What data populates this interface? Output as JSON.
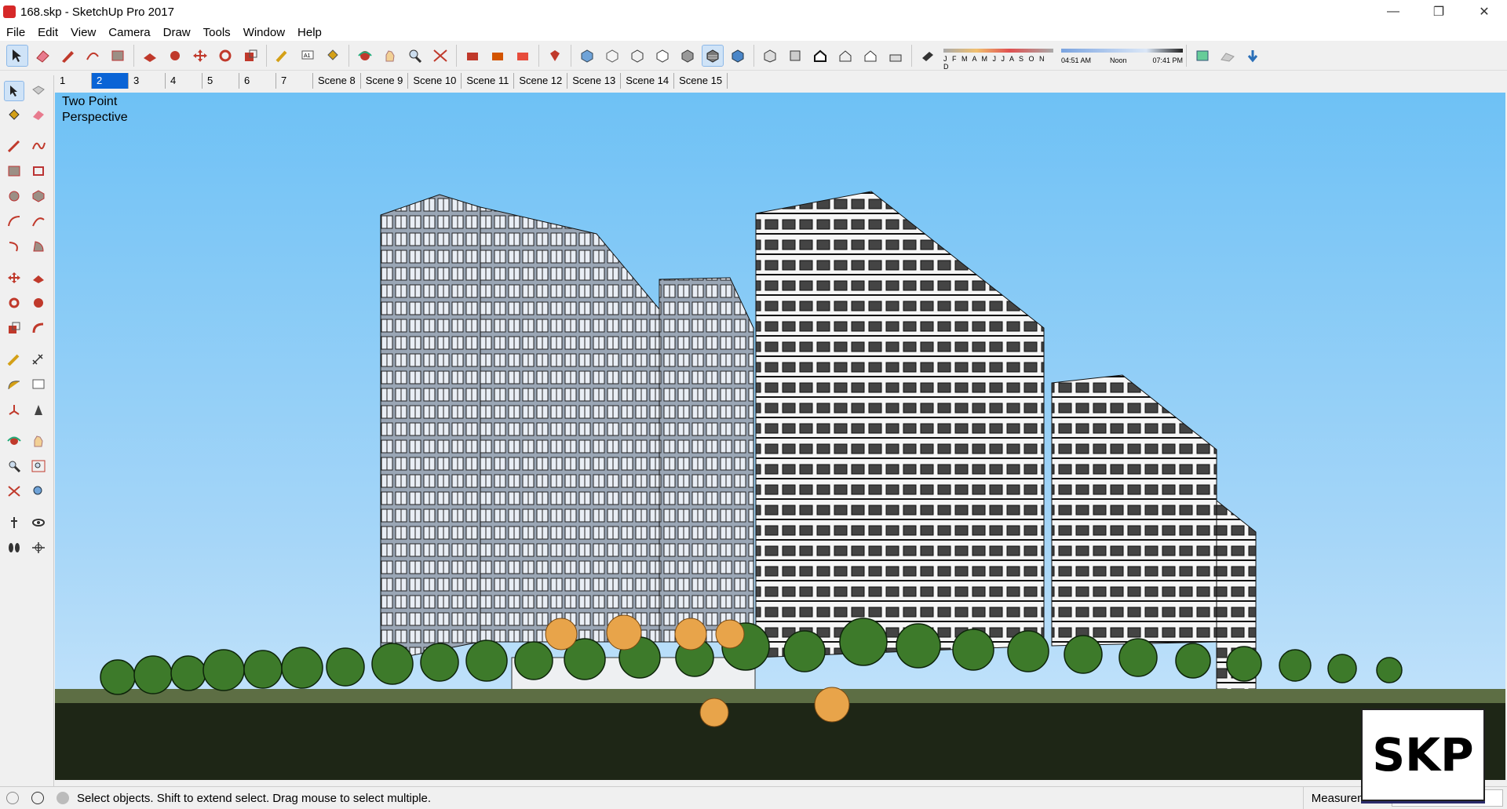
{
  "window": {
    "title": "168.skp - SketchUp Pro 2017",
    "min": "—",
    "max": "❐",
    "close": "✕"
  },
  "menu": [
    "File",
    "Edit",
    "View",
    "Camera",
    "Draw",
    "Tools",
    "Window",
    "Help"
  ],
  "shadow": {
    "months": "J F M A M J J A S O N D",
    "time_start": "04:51 AM",
    "time_mid": "Noon",
    "time_end": "07:41 PM"
  },
  "scenes": [
    "1",
    "2",
    "3",
    "4",
    "5",
    "6",
    "7",
    "Scene 8",
    "Scene 9",
    "Scene 10",
    "Scene 11",
    "Scene 12",
    "Scene 13",
    "Scene 14",
    "Scene 15"
  ],
  "active_scene": "2",
  "viewport": {
    "camera_line1": "Two Point",
    "camera_line2": "Perspective"
  },
  "status": {
    "text": "Select objects. Shift to extend select. Drag mouse to select multiple.",
    "measurements": "Measurements"
  },
  "badge": "SKP",
  "colors": {
    "accent": "#0a64d6",
    "sky": "#6ec1f5",
    "icon_red": "#c0392b"
  }
}
